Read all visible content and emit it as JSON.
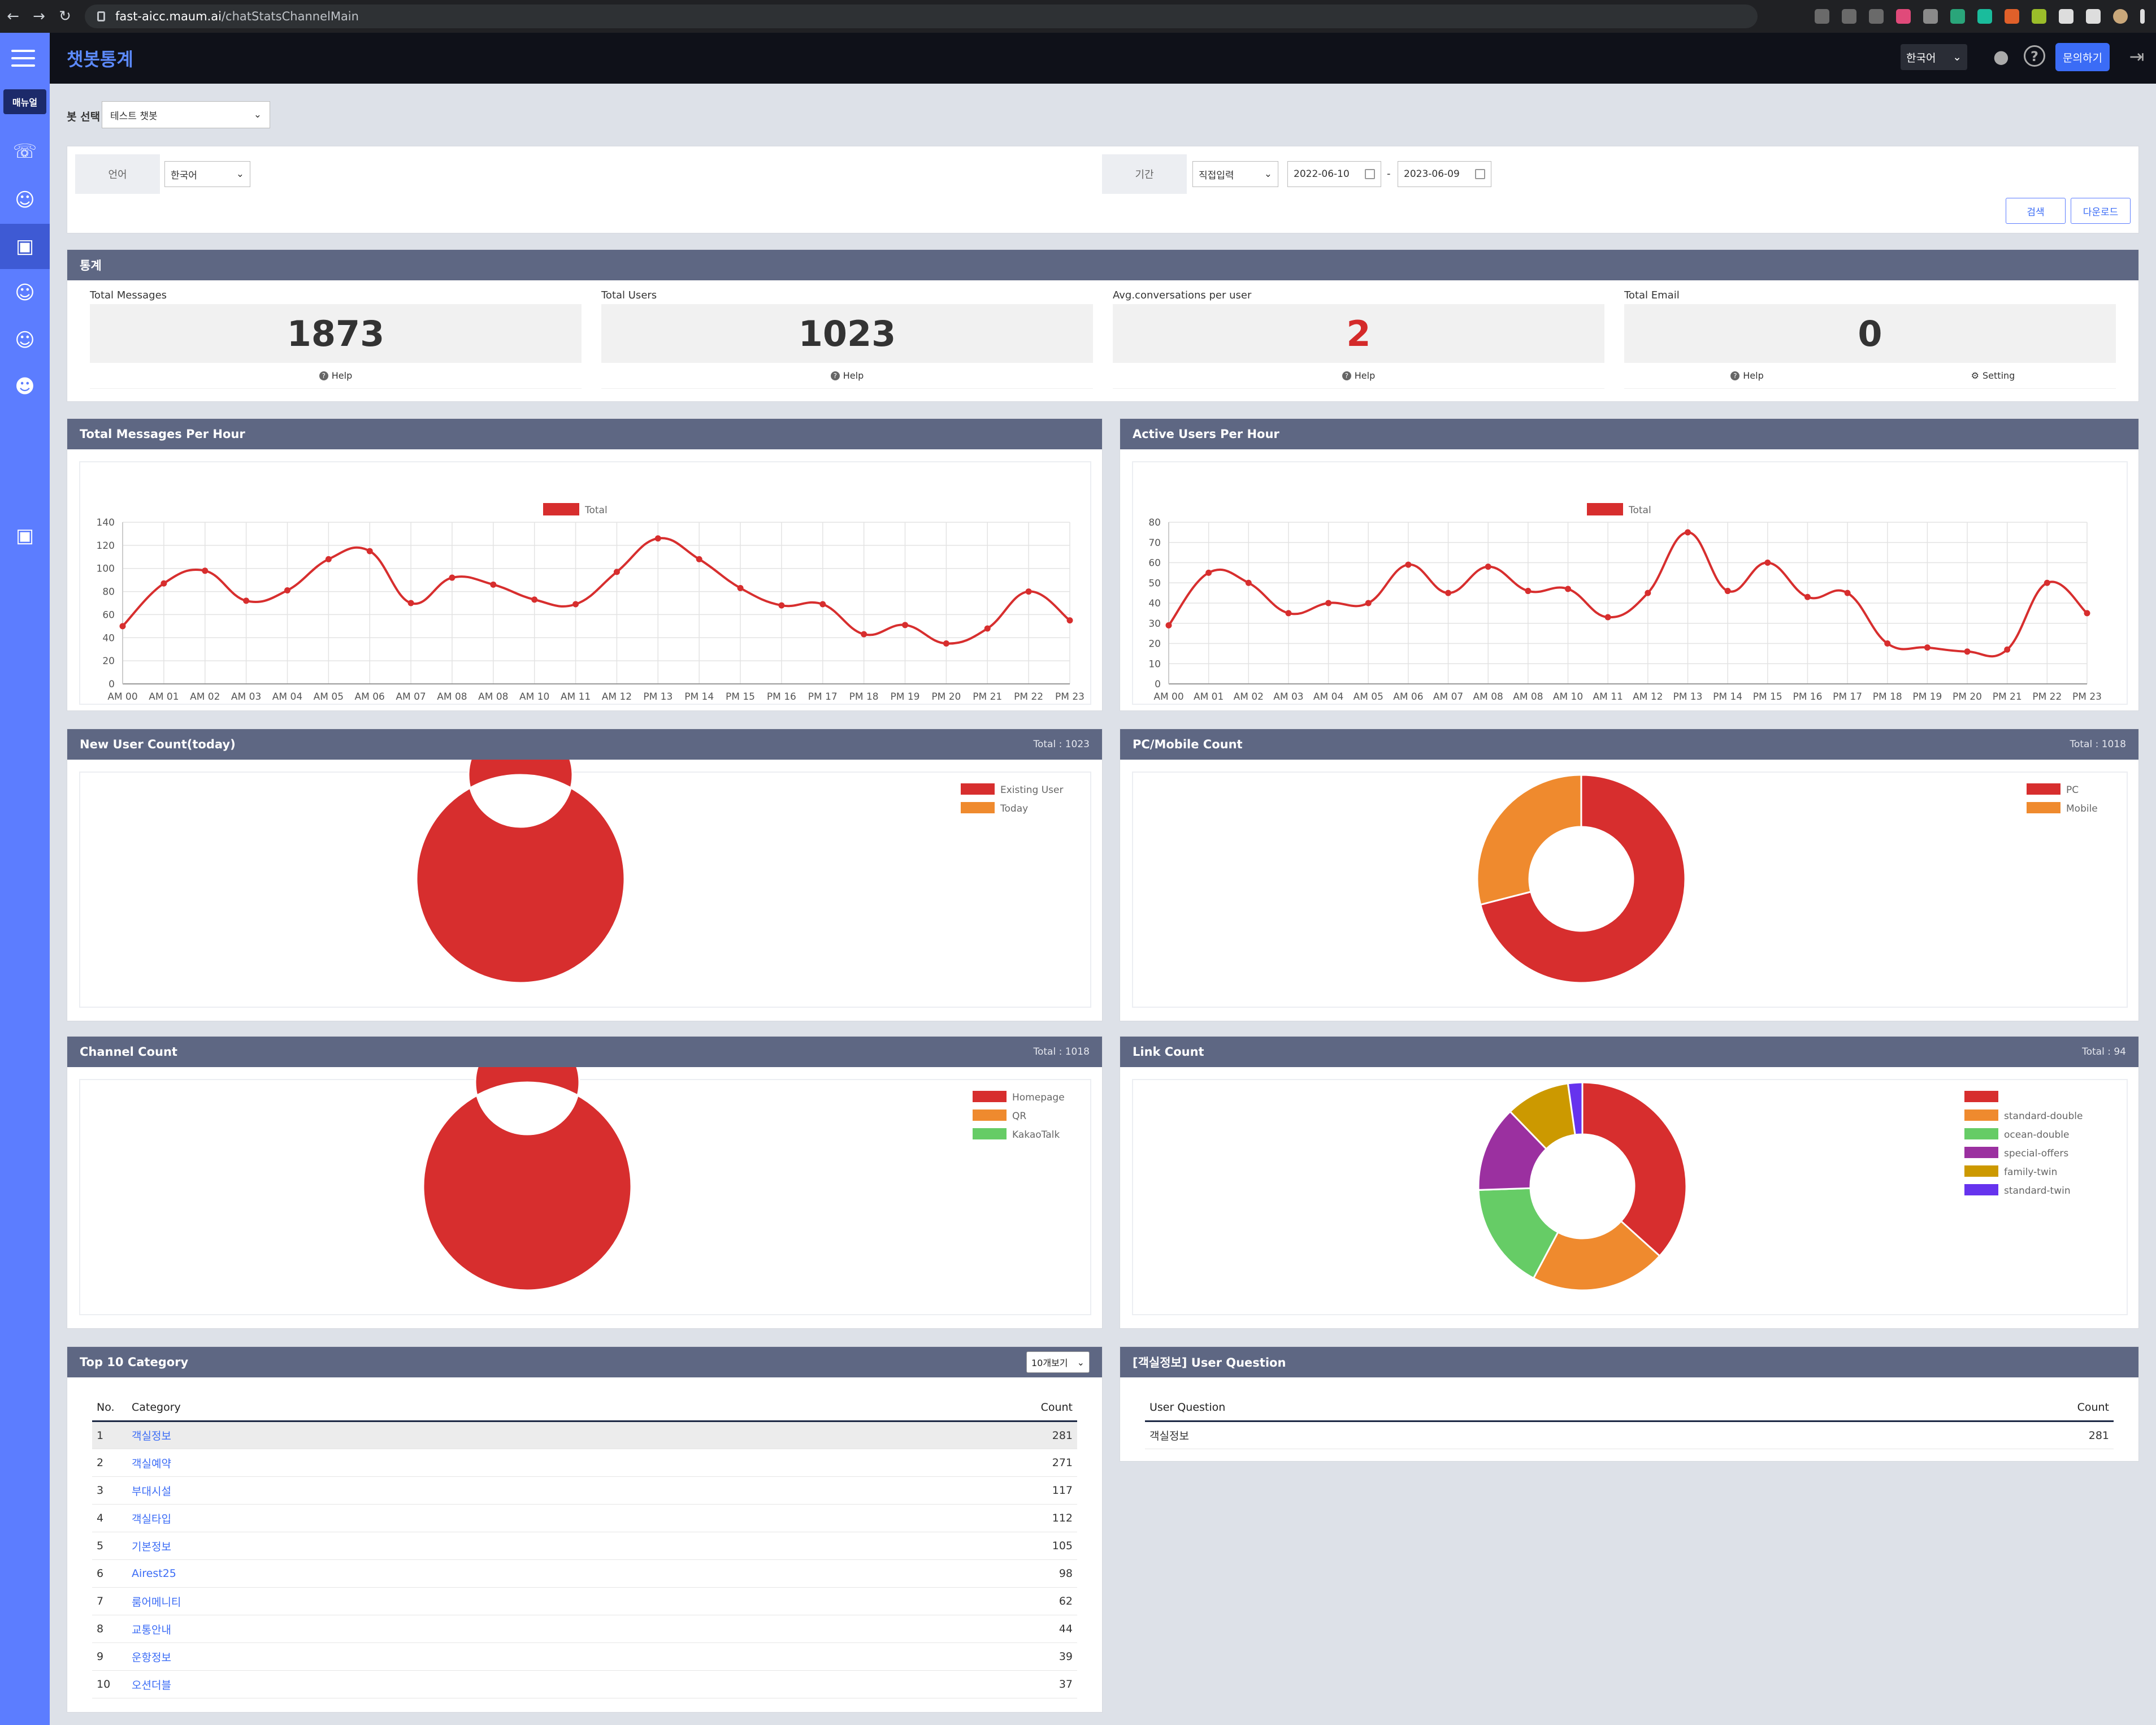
{
  "browser": {
    "url_host": "fast-aicc.maum.ai",
    "url_path": "/chatStatsChannelMain"
  },
  "sidebar": {
    "manual_label": "매뉴얼"
  },
  "header": {
    "title": "챗봇통계",
    "language": "한국어",
    "ask_button": "문의하기"
  },
  "bot_select": {
    "label": "봇 선택",
    "value": "테스트 챗봇"
  },
  "filters": {
    "language_label": "언어",
    "language_value": "한국어",
    "period_label": "기간",
    "period_mode": "직접입력",
    "start_date": "2022-06-10",
    "end_date": "2023-06-09",
    "date_separator": "-",
    "search_button": "검색",
    "download_button": "다운로드"
  },
  "stats": {
    "title": "통계",
    "cards": [
      {
        "label": "Total Messages",
        "value": "1873",
        "help": "Help"
      },
      {
        "label": "Total Users",
        "value": "1023",
        "help": "Help"
      },
      {
        "label": "Avg.conversations per user",
        "value": "2",
        "help": "Help"
      },
      {
        "label": "Total Email",
        "value": "0",
        "help": "Help",
        "setting": "Setting"
      }
    ]
  },
  "colors": {
    "red": "#d72e2e",
    "orange": "#ef8a2e",
    "green": "#66cc66",
    "purple": "#9b30a0",
    "mustard": "#cc9900",
    "violet": "#6633ee",
    "header": "#5e6783"
  },
  "hours": [
    "AM 00",
    "AM 01",
    "AM 02",
    "AM 03",
    "AM 04",
    "AM 05",
    "AM 06",
    "AM 07",
    "AM 08",
    "AM 08",
    "AM 10",
    "AM 11",
    "AM 12",
    "PM 13",
    "PM 14",
    "PM 15",
    "PM 16",
    "PM 17",
    "PM 18",
    "PM 19",
    "PM 20",
    "PM 21",
    "PM 22",
    "PM 23"
  ],
  "chart_data": [
    {
      "type": "line",
      "title": "Total Messages Per Hour",
      "series": [
        {
          "name": "Total",
          "values": [
            50,
            87,
            98,
            72,
            81,
            108,
            115,
            70,
            92,
            86,
            73,
            69,
            97,
            126,
            108,
            83,
            68,
            69,
            43,
            51,
            35,
            48,
            80,
            55
          ]
        }
      ],
      "ylim": [
        0,
        140
      ],
      "yticks": [
        0,
        20,
        40,
        60,
        80,
        100,
        120,
        140
      ]
    },
    {
      "type": "line",
      "title": "Active Users Per Hour",
      "series": [
        {
          "name": "Total",
          "values": [
            29,
            55,
            50,
            35,
            40,
            40,
            59,
            45,
            58,
            46,
            47,
            33,
            45,
            75,
            46,
            60,
            43,
            45,
            20,
            18,
            16,
            17,
            50,
            35
          ]
        }
      ],
      "ylim": [
        0,
        80
      ],
      "yticks": [
        0,
        10,
        20,
        30,
        40,
        50,
        60,
        70,
        80
      ]
    },
    {
      "type": "pie",
      "title": "New User Count(today)",
      "total_label": "Total : 1023",
      "labels": [
        "Existing User",
        "Today"
      ],
      "values": [
        1023,
        0
      ]
    },
    {
      "type": "pie",
      "title": "PC/Mobile Count",
      "total_label": "Total : 1018",
      "labels": [
        "PC",
        "Mobile"
      ],
      "values": [
        723,
        295
      ]
    },
    {
      "type": "pie",
      "title": "Channel Count",
      "total_label": "Total : 1018",
      "labels": [
        "Homepage",
        "QR",
        "KakaoTalk"
      ],
      "values": [
        1018,
        0,
        0
      ]
    },
    {
      "type": "pie",
      "title": "Link Count",
      "total_label": "Total : 94",
      "labels": [
        "",
        "standard-double",
        "ocean-double",
        "special-offers",
        "family-twin",
        "standard-twin"
      ],
      "values": [
        33,
        19,
        15,
        12,
        9,
        2
      ]
    }
  ],
  "top_category": {
    "title": "Top 10 Category",
    "select": "10개보기",
    "columns": [
      "No.",
      "Category",
      "Count"
    ],
    "rows": [
      [
        "1",
        "객실정보",
        "281"
      ],
      [
        "2",
        "객실예약",
        "271"
      ],
      [
        "3",
        "부대시설",
        "117"
      ],
      [
        "4",
        "객실타입",
        "112"
      ],
      [
        "5",
        "기본정보",
        "105"
      ],
      [
        "6",
        "Airest25",
        "98"
      ],
      [
        "7",
        "룸어메니티",
        "62"
      ],
      [
        "8",
        "교통안내",
        "44"
      ],
      [
        "9",
        "운항정보",
        "39"
      ],
      [
        "10",
        "오션더블",
        "37"
      ]
    ]
  },
  "user_question": {
    "title": "[객실정보] User Question",
    "columns": [
      "User Question",
      "Count"
    ],
    "rows": [
      [
        "객실정보",
        "281"
      ]
    ]
  }
}
